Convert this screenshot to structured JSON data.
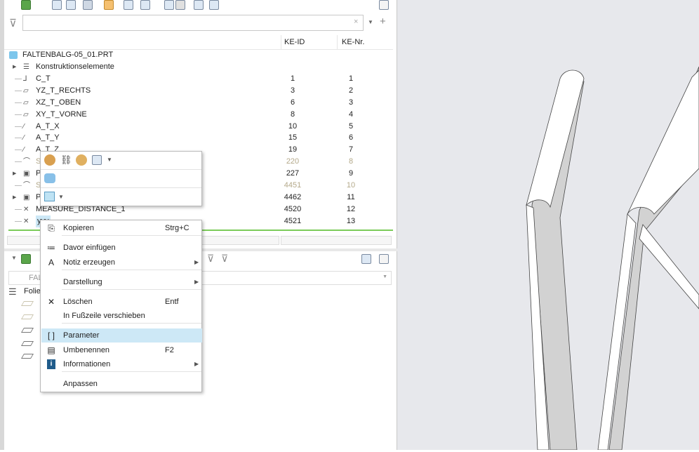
{
  "tree": {
    "filter_placeholder": "",
    "columns": {
      "id": "KE-ID",
      "nr": "KE-Nr."
    },
    "root": "FALTENBALG-05_01.PRT",
    "rows": [
      {
        "label": "Konstruktionselemente",
        "id": "",
        "nr": "",
        "icon": "list"
      },
      {
        "label": "C_T",
        "id": "1",
        "nr": "1",
        "icon": "csys"
      },
      {
        "label": "YZ_T_RECHTS",
        "id": "3",
        "nr": "2",
        "icon": "plane"
      },
      {
        "label": "XZ_T_OBEN",
        "id": "6",
        "nr": "3",
        "icon": "plane"
      },
      {
        "label": "XY_T_VORNE",
        "id": "8",
        "nr": "4",
        "icon": "plane"
      },
      {
        "label": "A_T_X",
        "id": "10",
        "nr": "5",
        "icon": "axis"
      },
      {
        "label": "A_T_Y",
        "id": "15",
        "nr": "6",
        "icon": "axis"
      },
      {
        "label": "A_T_Z",
        "id": "19",
        "nr": "7",
        "icon": "axis"
      },
      {
        "label": "S",
        "id": "220",
        "nr": "8",
        "icon": "sketch",
        "grey": true
      },
      {
        "label": "P",
        "id": "227",
        "nr": "9",
        "icon": "solid"
      },
      {
        "label": "S",
        "id": "4451",
        "nr": "10",
        "icon": "sketch",
        "grey": true
      },
      {
        "label": "P",
        "id": "4462",
        "nr": "11",
        "icon": "solid"
      },
      {
        "label": "MEASURE_DISTANCE_1",
        "id": "4520",
        "nr": "12",
        "icon": "measure"
      },
      {
        "label": "yyy",
        "id": "4521",
        "nr": "13",
        "icon": "measure",
        "selected": true
      }
    ]
  },
  "layers": {
    "combo": "FAL",
    "root": "Folie"
  },
  "menu": {
    "items": [
      {
        "label": "Kopieren",
        "key": "Strg+C",
        "icon": "copy"
      },
      {
        "label": "Davor einfügen",
        "icon": "insert"
      },
      {
        "label": "Notiz erzeugen",
        "sub": true,
        "icon": "note"
      },
      {
        "label": "Darstellung",
        "sub": true
      },
      {
        "label": "Löschen",
        "key": "Entf",
        "icon": "delete"
      },
      {
        "label": "In Fußzeile verschieben"
      },
      {
        "label": "Parameter",
        "icon": "parameter",
        "highlight": true
      },
      {
        "label": "Umbenennen",
        "key": "F2",
        "icon": "rename"
      },
      {
        "label": "Informationen",
        "sub": true,
        "icon": "info"
      },
      {
        "label": "Anpassen"
      }
    ]
  },
  "colors": {
    "accent": "#cde8f6",
    "viewport": "#e7e8ec"
  }
}
